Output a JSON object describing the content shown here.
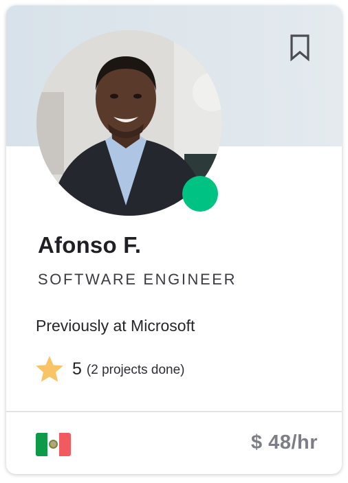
{
  "profile": {
    "name": "Afonso F.",
    "title": "SOFTWARE ENGINEER",
    "previous_employer": "Previously at Microsoft",
    "rating": "5",
    "projects_done": "(2 projects done)",
    "rate": "$ 48/hr",
    "status": "online"
  },
  "icons": {
    "bookmark": "bookmark-icon",
    "star": "star-icon",
    "flag": "mexico-flag-icon"
  },
  "colors": {
    "banner": "#dde5eb",
    "status_online": "#00c282",
    "star": "#f8c466",
    "rate_text": "#7d7e86",
    "flag_green": "#0e9b49",
    "flag_white": "#ffffff",
    "flag_red": "#f15a5e"
  }
}
